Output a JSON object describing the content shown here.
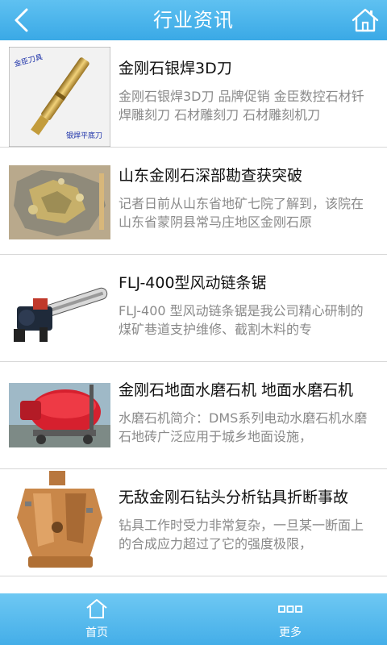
{
  "header": {
    "title": "行业资讯",
    "back_icon": "back-arrow-icon",
    "home_icon": "home-icon"
  },
  "news": [
    {
      "title": "金刚石银焊3D刀",
      "desc": "金刚石银焊3D刀 品牌促销 金臣数控石材钎焊雕刻刀 石材雕刻刀 石材雕刻机刀",
      "image_caption_top": "金臣刀具",
      "image_caption_bottom": "银焊平底刀"
    },
    {
      "title": "山东金刚石深部勘查获突破",
      "desc": "记者日前从山东省地矿七院了解到，该院在山东省蒙阴县常马庄地区金刚石原"
    },
    {
      "title": "FLJ-400型风动链条锯",
      "desc": "FLJ-400 型风动链条锯是我公司精心研制的煤矿巷道支护维修、截割木料的专"
    },
    {
      "title": "金刚石地面水磨石机 地面水磨石机",
      "desc": "水磨石机简介：DMS系列电动水磨石机水磨石地砖广泛应用于城乡地面设施，"
    },
    {
      "title": "无敌金刚石钻头分析钻具折断事故",
      "desc": "钻具工作时受力非常复杂，一旦某一断面上的合成应力超过了它的强度极限，"
    }
  ],
  "tabbar": {
    "home_label": "首页",
    "more_label": "更多"
  }
}
